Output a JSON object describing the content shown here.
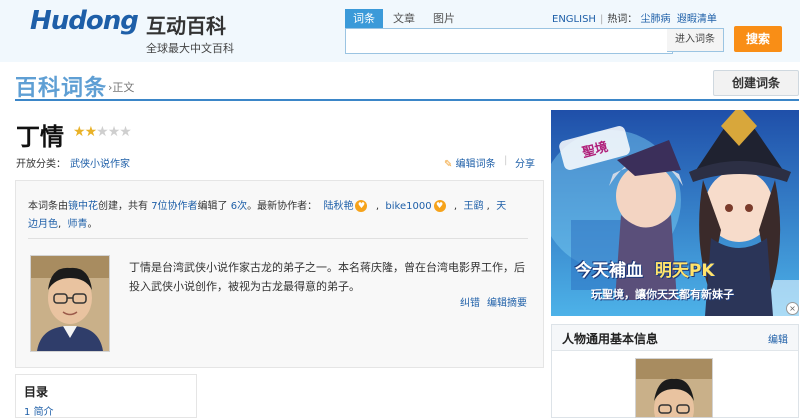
{
  "header": {
    "logo_en": "Hudong",
    "logo_cn": "互动百科",
    "logo_sub": "全球最大中文百科",
    "tabs": [
      "词条",
      "文章",
      "图片"
    ],
    "english_link": "ENGLISH",
    "hot_label": "热词：",
    "hot_words": [
      "尘肺病",
      "遐暇清单"
    ],
    "search_value": "",
    "search_in_entry": "进入词条",
    "search_button": "搜索"
  },
  "section": {
    "title": "百科词条",
    "crumb": "›正文",
    "create_button": "创建词条"
  },
  "entry": {
    "title": "丁情",
    "rating": 1.5,
    "rating_max": 5,
    "category_label": "开放分类：",
    "category_value": "武侠小说作家",
    "edit_link": "编辑词条",
    "share_link": "分享"
  },
  "contributors": {
    "t1": "本词条由",
    "creator": "镜中花",
    "t2": "创建，共有",
    "count_link": "7位协作者",
    "t3": "编辑了",
    "edit_times": "6次",
    "t4": "。最新协作者：",
    "users": [
      "陆秋艳",
      "bike1000",
      "王鹞"
    ],
    "user_last_a": "天",
    "user_last_b": "边月色",
    "user_tail": "师青",
    "end": "。"
  },
  "summary": {
    "text": "丁情是台湾武侠小说作家古龙的弟子之一。本名蒋庆隆，曾在台湾电影界工作，后投入武侠小说创作，被视为古龙最得意的弟子。",
    "action_correct": "纠错",
    "action_edit": "编辑摘要"
  },
  "toc": {
    "title": "目录",
    "items": [
      {
        "num": "1",
        "label": "简介"
      }
    ]
  },
  "ad": {
    "caption1": "今天補血",
    "caption2": "明天PK",
    "subcaption": "玩聖境，讓你天天都有新妹子",
    "close": "×"
  },
  "info_panel": {
    "title": "人物通用基本信息",
    "edit": "编辑"
  },
  "colors": {
    "brand_blue": "#1e5fa8",
    "accent_orange": "#f98e16",
    "section_line": "#3b86c8"
  }
}
